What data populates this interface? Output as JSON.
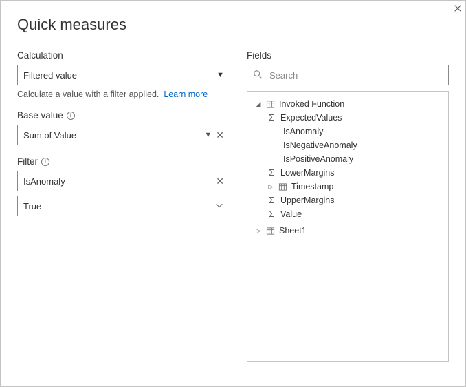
{
  "title": "Quick measures",
  "left": {
    "calc_label": "Calculation",
    "calc_value": "Filtered value",
    "help_text": "Calculate a value with a filter applied.",
    "learn_more": "Learn more",
    "base_label": "Base value",
    "base_value": "Sum of Value",
    "filter_label": "Filter",
    "filter_field": "IsAnomaly",
    "filter_value": "True"
  },
  "right": {
    "fields_label": "Fields",
    "search_placeholder": "Search",
    "tree": {
      "table1": "Invoked Function",
      "f_expected": "ExpectedValues",
      "f_isanom": "IsAnomaly",
      "f_isneg": "IsNegativeAnomaly",
      "f_ispos": "IsPositiveAnomaly",
      "f_lower": "LowerMargins",
      "f_ts": "Timestamp",
      "f_upper": "UpperMargins",
      "f_value": "Value",
      "table2": "Sheet1"
    }
  }
}
